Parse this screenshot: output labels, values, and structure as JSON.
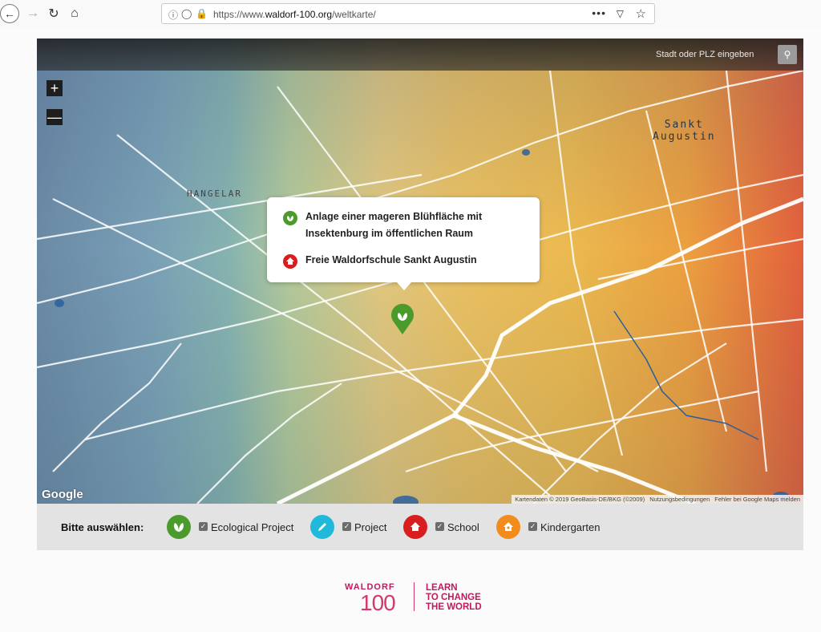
{
  "browser": {
    "url_prefix": "https://www.",
    "url_domain": "waldorf-100.org",
    "url_path": "/weltkarte/",
    "menu_label": "•••"
  },
  "map": {
    "search_placeholder": "Stadt oder PLZ eingeben",
    "zoom_in_label": "+",
    "zoom_out_label": "—",
    "places": {
      "hangelar": "HANGELAR",
      "sankt_line1": "Sankt",
      "sankt_line2": "Augustin"
    },
    "popup": {
      "entries": [
        {
          "text": "Anlage einer mageren Blühfläche mit Insektenburg im öffentlichen Raum",
          "icon": "leaf-icon",
          "color": "#4a9a2c"
        },
        {
          "text": "Freie Waldorfschule Sankt Augustin",
          "icon": "school-icon",
          "color": "#d81e1e"
        }
      ]
    },
    "google_logo": "Google",
    "attribution": {
      "data": "Kartendaten © 2019 GeoBasis-DE/BKG (©2009)",
      "terms": "Nutzungsbedingungen",
      "report": "Fehler bei Google Maps melden"
    }
  },
  "filters": {
    "title": "Bitte auswählen:",
    "items": [
      {
        "label": "Ecological Project",
        "color": "#4a9a2c",
        "icon": "leaf-icon",
        "checked": true
      },
      {
        "label": "Project",
        "color": "#21b9d9",
        "icon": "pencil-icon",
        "checked": true
      },
      {
        "label": "School",
        "color": "#d81e1e",
        "icon": "school-icon",
        "checked": true
      },
      {
        "label": "Kindergarten",
        "color": "#f28c1d",
        "icon": "house-icon",
        "checked": true
      }
    ]
  },
  "brand": {
    "left_top": "WALDORF",
    "left_bottom": "100",
    "right_line1": "LEARN",
    "right_line2": "TO CHANGE",
    "right_line3": "THE WORLD"
  }
}
